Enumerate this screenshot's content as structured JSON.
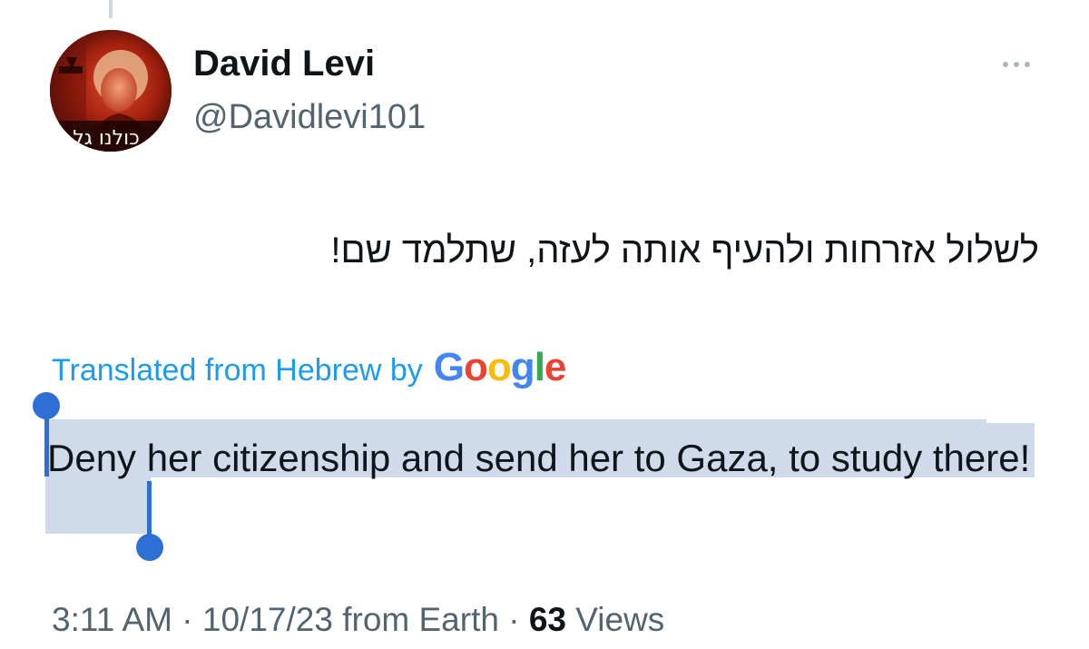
{
  "tweet": {
    "author": {
      "display_name": "David Levi",
      "handle": "@Davidlevi101",
      "avatar_overlay_text": "כולנו גל"
    },
    "original_text": "לשלול אזרחות ולהעיף אותה לעזה, שתלמד שם!",
    "translation": {
      "credit_label": "Translated from Hebrew by",
      "provider_logo": {
        "letters": [
          "G",
          "o",
          "o",
          "g",
          "l",
          "e"
        ]
      },
      "text": "Deny her citizenship and send her to Gaza, to study there!"
    },
    "meta": {
      "time": "3:11 AM",
      "separator": "·",
      "date": "10/17/23",
      "source": "from Earth",
      "views_count": "63",
      "views_label": "Views"
    }
  },
  "icons": {
    "more": "more-horizontal-icon"
  },
  "colors": {
    "link_blue": "#1d9bf0",
    "selection_highlight": "#cfdaea",
    "selection_handle": "#2e6fd6",
    "secondary_text": "#536471",
    "primary_text": "#0f1419",
    "google_blue": "#4285f4",
    "google_red": "#ea4335",
    "google_yellow": "#fbbc05",
    "google_green": "#34a853"
  }
}
